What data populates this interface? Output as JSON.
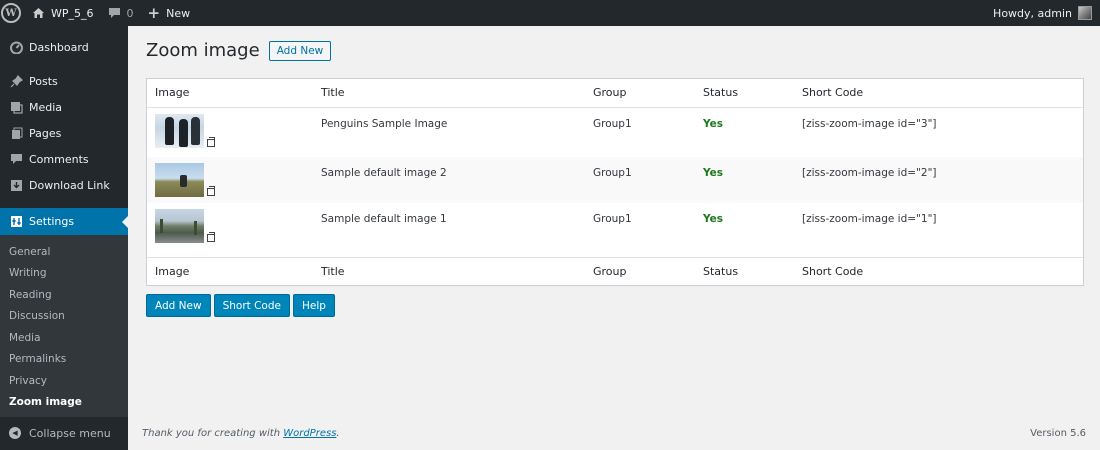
{
  "adminbar": {
    "site_name": "WP_5_6",
    "comments_count": "0",
    "new_label": "New",
    "greeting": "Howdy, admin"
  },
  "sidebar": {
    "items": [
      {
        "label": "Dashboard",
        "icon": "dashboard-icon"
      },
      {
        "label": "Posts",
        "icon": "pin-icon"
      },
      {
        "label": "Media",
        "icon": "media-icon"
      },
      {
        "label": "Pages",
        "icon": "pages-icon"
      },
      {
        "label": "Comments",
        "icon": "comment-icon"
      },
      {
        "label": "Download Link",
        "icon": "download-icon"
      }
    ],
    "current": {
      "label": "Settings",
      "icon": "settings-icon"
    },
    "submenu": [
      "General",
      "Writing",
      "Reading",
      "Discussion",
      "Media",
      "Permalinks",
      "Privacy",
      "Zoom image"
    ],
    "collapse_label": "Collapse menu"
  },
  "main": {
    "title": "Zoom image",
    "add_new_label": "Add New",
    "table": {
      "columns": [
        "Image",
        "Title",
        "Group",
        "Status",
        "Short Code"
      ],
      "rows": [
        {
          "title": "Penguins Sample Image",
          "group": "Group1",
          "status": "Yes",
          "shortcode": "[ziss-zoom-image id=\"3\"]"
        },
        {
          "title": "Sample default image 2",
          "group": "Group1",
          "status": "Yes",
          "shortcode": "[ziss-zoom-image id=\"2\"]"
        },
        {
          "title": "Sample default image 1",
          "group": "Group1",
          "status": "Yes",
          "shortcode": "[ziss-zoom-image id=\"1\"]"
        }
      ]
    },
    "buttons": {
      "add_new": "Add New",
      "short_code": "Short Code",
      "help": "Help"
    }
  },
  "footer": {
    "thanks_prefix": "Thank you for creating with ",
    "thanks_link": "WordPress",
    "thanks_suffix": ".",
    "version": "Version 5.6"
  },
  "colors": {
    "accent": "#0073aa",
    "sidebar_bg": "#23282d",
    "status_yes": "#1b7a1b"
  }
}
